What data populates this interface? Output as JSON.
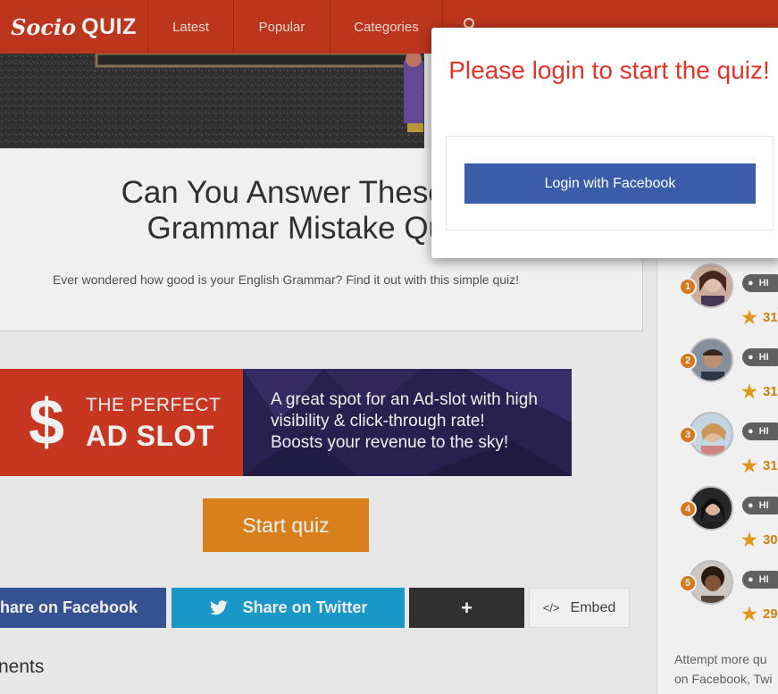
{
  "header": {
    "logo_script": "Socio",
    "logo_bold": "QUIZ",
    "nav": [
      "Latest",
      "Popular",
      "Categories"
    ]
  },
  "quiz": {
    "title_line1": "Can You Answer These Com",
    "title_line2": "Grammar Mistake Questi",
    "description": "Ever wondered how good is your English Grammar? Find it out with this simple quiz!",
    "start_label": "Start quiz"
  },
  "ad": {
    "dollar": "$",
    "line_small": "THE PERFECT",
    "line_big": "AD SLOT",
    "text1": "A great spot for an Ad-slot with high",
    "text2": "visibility & click-through rate!",
    "text3": "Boosts your revenue to the sky!"
  },
  "share": {
    "facebook": "hare on Facebook",
    "twitter": "Share on Twitter",
    "plus": "+",
    "embed": "Embed"
  },
  "comments_label": "nents",
  "leaderboard": [
    {
      "rank": "1",
      "badge": "HI",
      "score": "31"
    },
    {
      "rank": "2",
      "badge": "HI",
      "score": "31"
    },
    {
      "rank": "3",
      "badge": "HI",
      "score": "31"
    },
    {
      "rank": "4",
      "badge": "HI",
      "score": "30"
    },
    {
      "rank": "5",
      "badge": "HI",
      "score": "29"
    }
  ],
  "sidebar_note": {
    "line1": "Attempt more qu",
    "line2": "on Facebook, Twi"
  },
  "modal": {
    "title": "Please login to start the quiz!",
    "button": "Login with Facebook"
  },
  "colors": {
    "brand": "#c8391f",
    "facebook": "#3b5ca8",
    "twitter": "#1ba1d4",
    "start": "#e68a1e",
    "modal_title": "#e63328"
  }
}
